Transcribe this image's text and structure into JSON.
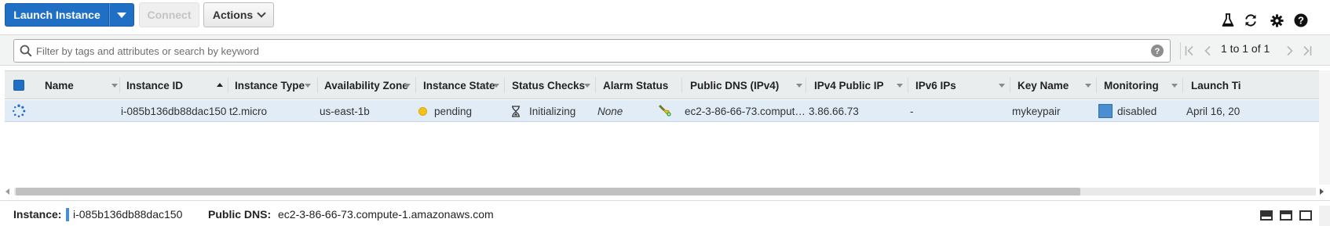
{
  "toolbar": {
    "launch_label": "Launch Instance",
    "connect_label": "Connect",
    "actions_label": "Actions",
    "icons": [
      "flask-icon",
      "refresh-icon",
      "gear-icon",
      "help-icon"
    ]
  },
  "filter": {
    "placeholder": "Filter by tags and attributes or search by keyword",
    "pagination": "1 to 1 of 1"
  },
  "table": {
    "columns": [
      "Name",
      "Instance ID",
      "Instance Type",
      "Availability Zone",
      "Instance State",
      "Status Checks",
      "Alarm Status",
      "Public DNS (IPv4)",
      "IPv4 Public IP",
      "IPv6 IPs",
      "Key Name",
      "Monitoring",
      "Launch Ti"
    ],
    "sorted_column": "Instance ID",
    "rows": [
      {
        "name": "",
        "instance_id": "i-085b136db88dac150",
        "instance_type": "t2.micro",
        "availability_zone": "us-east-1b",
        "instance_state": "pending",
        "status_checks": "Initializing",
        "alarm_status": "None",
        "public_dns": "ec2-3-86-66-73.comput…",
        "ipv4_public_ip": "3.86.66.73",
        "ipv6_ips": "-",
        "key_name": "mykeypair",
        "monitoring": "disabled",
        "launch_time": "April 16, 20"
      }
    ]
  },
  "detail": {
    "instance_label": "Instance:",
    "instance_value": "i-085b136db88dac150",
    "dns_label": "Public DNS:",
    "dns_value": "ec2-3-86-66-73.compute-1.amazonaws.com"
  },
  "colors": {
    "primary": "#1f6fc5",
    "pending": "#f2c318",
    "row_selected": "#e2ecf7",
    "monitoring_box": "#4a8ed1"
  }
}
